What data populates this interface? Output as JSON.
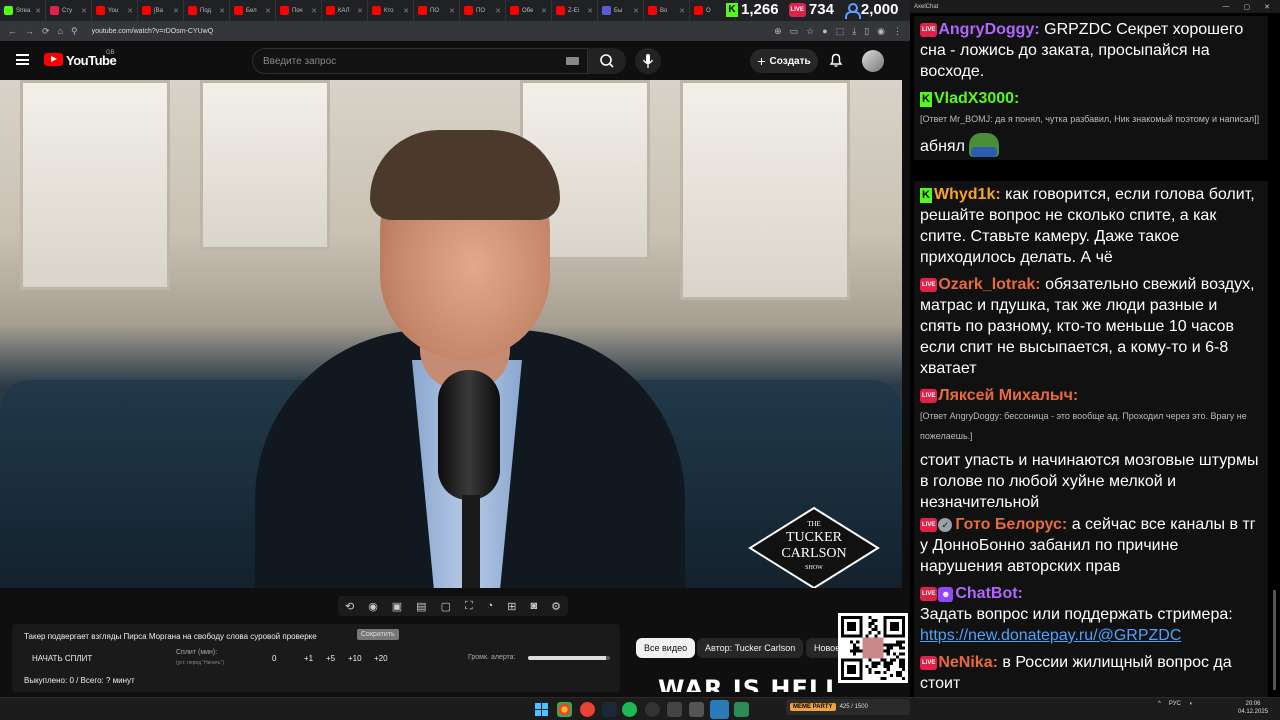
{
  "browser": {
    "tabs": [
      {
        "label": "Strea",
        "color": "#53fc18"
      },
      {
        "label": "Сту",
        "color": "#e0224b"
      },
      {
        "label": "You",
        "color": "#ff0000"
      },
      {
        "label": "[Ва",
        "color": "#ff0000"
      },
      {
        "label": "Под",
        "color": "#ff0000"
      },
      {
        "label": "Бел",
        "color": "#ff0000"
      },
      {
        "label": "Поч",
        "color": "#ff0000"
      },
      {
        "label": "КАЛ",
        "color": "#ff0000"
      },
      {
        "label": "Кто",
        "color": "#ff0000"
      },
      {
        "label": "ПО",
        "color": "#ff0000"
      },
      {
        "label": "ПО",
        "color": "#ff0000"
      },
      {
        "label": "Обе",
        "color": "#ff0000"
      },
      {
        "label": "Z-Ei",
        "color": "#ff0000"
      },
      {
        "label": "Бы",
        "color": "#5b5bd6"
      },
      {
        "label": "Во",
        "color": "#ff0000"
      },
      {
        "label": "О",
        "color": "#ff0000"
      }
    ],
    "url": "youtube.com/watch?v=rDOsm-CYUwQ"
  },
  "stats": {
    "kick_viewers": "1,266",
    "live_viewers": "734",
    "total_viewers": "2,000"
  },
  "youtube": {
    "logo_text": "YouTube",
    "region": "GB",
    "search_placeholder": "Введите запрос",
    "create_label": "Создать"
  },
  "video": {
    "logo_line1": "THE",
    "logo_line2": "TUCKER",
    "logo_line3": "CARLSON",
    "logo_line4": "SHOW"
  },
  "split": {
    "title": "Такер подвергает взгляды Пирса Моргана на свободу слова суровой проверке",
    "tag": "Сократить",
    "start_label": "НАЧАТЬ СПЛИТ",
    "min_label": "Сплит (мин):",
    "min_hint": "(уст. перед \"Начать\")",
    "values": [
      "0",
      "+1",
      "+5",
      "+10",
      "+20"
    ],
    "alert_label": "Громк. алерта:",
    "alert_volume": 0.95,
    "footer": "Выкуплено: 0 / Всего: ? минут"
  },
  "chips": {
    "all": "Все видео",
    "author": "Автор: Tucker Carlson",
    "new": "Новое"
  },
  "overlay_text": "WAR IS HELL",
  "chat": {
    "window_title": "AxelChat",
    "messages": [
      {
        "badge": "live",
        "user": "AngryDoggy:",
        "user_color": "#b266ff",
        "text": "GRPZDC Секрет хорошего сна - ложись до заката, просыпайся на восходе."
      },
      {
        "badge": "kick",
        "user": "VladX3000:",
        "user_color": "#53fc18",
        "reply": "[Ответ Mr_BOMJ: да я понял, чутка разбавил, Ник знакомый поэтому и написал]]",
        "text": "абнял"
      },
      {
        "badge": "kick",
        "user": "Whyd1k:",
        "user_color": "#f5a623",
        "text": "как говорится, если голова болит, решайте вопрос не сколько спите, а как спите. Ставьте камеру. Даже такое приходилось делать. А чё"
      },
      {
        "badge": "live",
        "user": "Ozark_lotrak:",
        "user_color": "#e86a3a",
        "text": "обязательно свежий воздух, матрас и пдушка, так же люди разные и спять по разному, кто-то меньше 10 часов если спит не высыпается, а кому-то и 6-8 хватает"
      },
      {
        "badge": "live",
        "user": "Ляксей Михалыч:",
        "user_color": "#e86a3a",
        "reply": "[Ответ AngryDoggy: бессоница - это вообще ад. Проходил через это. Врагу не пожелаешь.]",
        "text": "стоит упасть и начинаются мозговые штурмы в голове по любой хуйне мелкой и незначительной"
      },
      {
        "badge": "live-check",
        "user": "Гото Белорус:",
        "user_color": "#e86a3a",
        "text": "а сейчас все каналы в тг у ДонноБонно забанил по причине нарушения авторских прав"
      },
      {
        "badge": "live-bot",
        "user": "ChatBot:",
        "user_color": "#b266ff",
        "text": "Задать вопрос или поддержать стримера:",
        "link": "https://new.donatepay.ru/@GRPZDC"
      },
      {
        "badge": "live",
        "user": "NeNika:",
        "user_color": "#e86a3a",
        "text": "в России жилищный вопрос да стоит"
      }
    ]
  },
  "taskbar": {
    "meme_label": "MEME PARTY",
    "meme_stat": "425 / 1500",
    "lang": "РУС",
    "time": "20:06",
    "date": "04.12.2025"
  }
}
